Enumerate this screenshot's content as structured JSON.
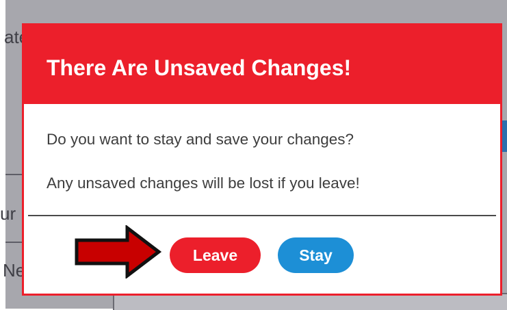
{
  "background": {
    "fragments": [
      "ate",
      "ur",
      "Ne"
    ]
  },
  "dialog": {
    "title": "There Are Unsaved Changes!",
    "message_line1": "Do you want to stay and save your changes?",
    "message_line2": "Any unsaved changes will be lost if you leave!",
    "leave_label": "Leave",
    "stay_label": "Stay"
  },
  "colors": {
    "accent_red": "#ec1f2b",
    "accent_blue": "#1d8fd6",
    "arrow_fill": "#c80000"
  },
  "icons": {
    "annotation": "right-arrow-icon"
  }
}
